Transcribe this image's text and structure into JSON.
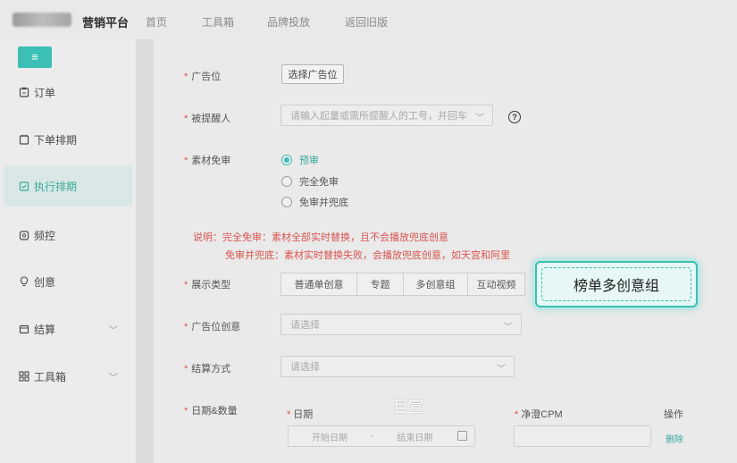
{
  "topbar": {
    "brand": "营销平台",
    "nav": [
      "首页",
      "工具箱",
      "品牌投放",
      "返回旧版"
    ]
  },
  "sidebar": {
    "toggle_icon": "≡",
    "items": [
      {
        "label": "订单",
        "icon": "clipboard-icon"
      },
      {
        "label": "下单排期",
        "icon": "calendar-icon"
      },
      {
        "label": "执行排期",
        "icon": "calendar-check-icon",
        "active": true
      },
      {
        "label": "频控",
        "icon": "frequency-icon"
      },
      {
        "label": "创意",
        "icon": "lightbulb-icon"
      },
      {
        "label": "结算",
        "icon": "wallet-icon",
        "expandable": true
      },
      {
        "label": "工具箱",
        "icon": "grid-icon",
        "expandable": true
      }
    ]
  },
  "form": {
    "ad_slot": {
      "label": "广告位",
      "button": "选择广告位"
    },
    "reminder": {
      "label": "被提醒人",
      "placeholder": "请输入起量或需所提醒人的工号，并回车"
    },
    "material_review": {
      "label": "素材免审",
      "options": [
        "预审",
        "完全免审",
        "免审并兜底"
      ],
      "selected": 0
    },
    "notes": [
      "说明：完全免审：素材全部实时替换，且不会播放兜底创意",
      "免审并兜底：素材实时替换失败，会播放兜底创意，如天宫和阿里"
    ],
    "display_type": {
      "label": "展示类型",
      "options": [
        "普通单创意",
        "专题",
        "多创意组",
        "互动视频"
      ],
      "highlight": "榜单多创意组"
    },
    "slot_creative": {
      "label": "广告位创意",
      "placeholder": "请选择"
    },
    "settlement": {
      "label": "结算方式",
      "placeholder": "请选择"
    },
    "date_qty": {
      "label": "日期&数量",
      "columns": [
        "日期",
        "净澄CPM",
        "操作"
      ],
      "start_placeholder": "开始日期",
      "separator": "-",
      "end_placeholder": "结束日期",
      "delete_label": "删除"
    }
  },
  "watermark": "巨宣",
  "colors": {
    "accent": "#3cbfb4",
    "required": "#d9534f"
  }
}
